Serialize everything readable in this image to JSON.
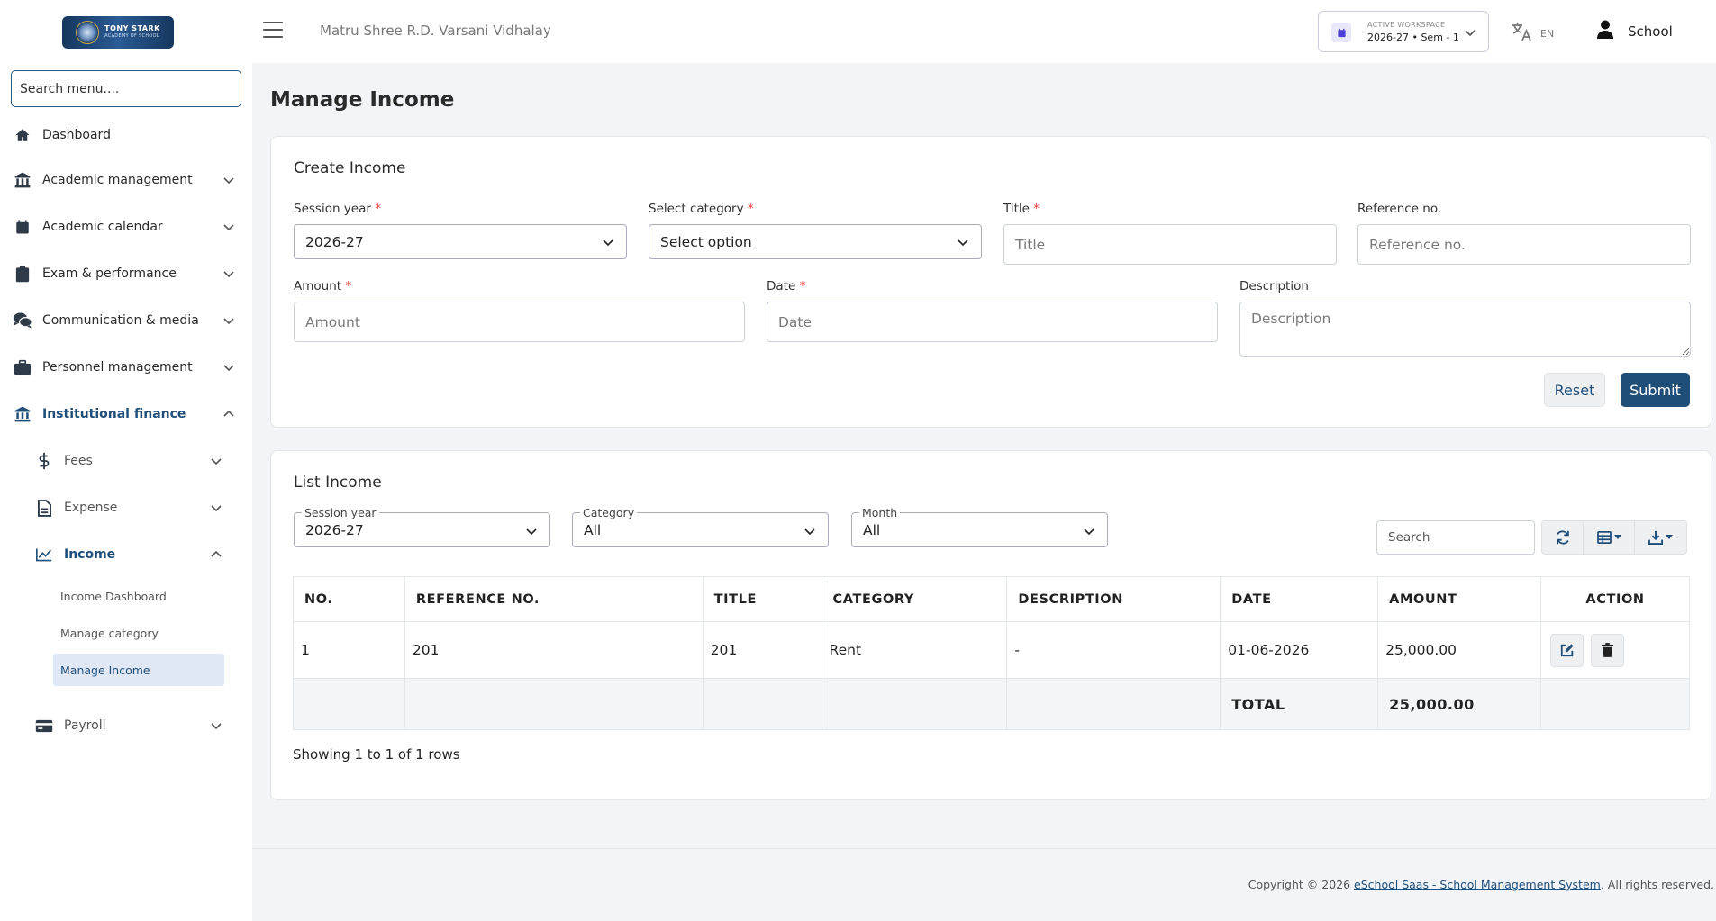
{
  "sidebar": {
    "logo_title": "TONY STARK",
    "logo_sub": "ACADEMY OF SCHOOL",
    "search_placeholder": "Search menu....",
    "items": [
      {
        "label": "Dashboard",
        "icon": "home-icon"
      },
      {
        "label": "Academic management",
        "icon": "bank-icon"
      },
      {
        "label": "Academic calendar",
        "icon": "calendar-icon"
      },
      {
        "label": "Exam & performance",
        "icon": "clipboard-icon"
      },
      {
        "label": "Communication & media",
        "icon": "comments-icon"
      },
      {
        "label": "Personnel management",
        "icon": "briefcase-icon"
      },
      {
        "label": "Institutional finance",
        "icon": "bank-icon"
      }
    ],
    "finance_sub": [
      {
        "label": "Fees",
        "icon": "dollar-icon"
      },
      {
        "label": "Expense",
        "icon": "file-icon"
      },
      {
        "label": "Income",
        "icon": "chart-line-icon"
      },
      {
        "label": "Payroll",
        "icon": "credit-card-icon"
      }
    ],
    "income_leaves": [
      "Income Dashboard",
      "Manage category",
      "Manage Income"
    ]
  },
  "header": {
    "school_name": "Matru Shree R.D. Varsani Vidhalay",
    "workspace_label": "ACTIVE WORKSPACE",
    "workspace_value": "2026-27 • Sem - 1",
    "language": "EN",
    "user_name": "School"
  },
  "page_title": "Manage Income",
  "create_form": {
    "title": "Create Income",
    "session_year_label": "Session year",
    "session_year_value": "2026-27",
    "category_label": "Select category",
    "category_value": "Select option",
    "title_label": "Title",
    "title_placeholder": "Title",
    "reference_label": "Reference no.",
    "reference_placeholder": "Reference no.",
    "amount_label": "Amount",
    "amount_placeholder": "Amount",
    "date_label": "Date",
    "date_placeholder": "Date",
    "description_label": "Description",
    "description_placeholder": "Description",
    "required_mark": "*",
    "reset_label": "Reset",
    "submit_label": "Submit"
  },
  "list": {
    "title": "List Income",
    "filters": {
      "session_year_label": "Session year",
      "session_year_value": "2026-27",
      "category_label": "Category",
      "category_value": "All",
      "month_label": "Month",
      "month_value": "All"
    },
    "search_placeholder": "Search",
    "columns": [
      "NO.",
      "REFERENCE NO.",
      "TITLE",
      "CATEGORY",
      "DESCRIPTION",
      "DATE",
      "AMOUNT",
      "ACTION"
    ],
    "rows": [
      {
        "no": "1",
        "reference": "201",
        "title": "201",
        "category": "Rent",
        "description": "-",
        "date": "01-06-2026",
        "amount": "25,000.00"
      }
    ],
    "total_label": "TOTAL",
    "total_value": "25,000.00",
    "showing": "Showing 1 to 1 of 1 rows"
  },
  "footer": {
    "prefix": "Copyright © 2026 ",
    "link": "eSchool Saas - School Management System",
    "suffix": ". All rights reserved."
  },
  "colors": {
    "primary": "#1f4e79",
    "required": "#e53935",
    "active_bg": "#dfe8f4"
  }
}
